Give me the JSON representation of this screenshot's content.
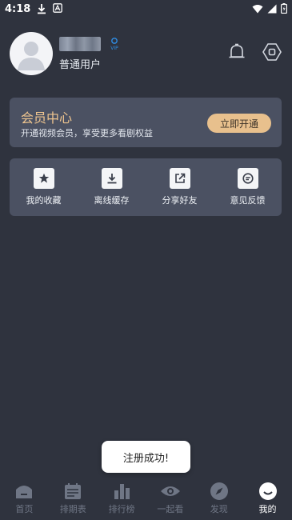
{
  "status": {
    "time": "4:18"
  },
  "profile": {
    "level": "普通用户",
    "vip_icon": "vip-badge-icon"
  },
  "member": {
    "title": "会员中心",
    "subtitle": "开通视频会员，享受更多看剧权益",
    "button": "立即开通"
  },
  "tools": [
    {
      "label": "我的收藏",
      "icon": "star-icon"
    },
    {
      "label": "离线缓存",
      "icon": "download-icon"
    },
    {
      "label": "分享好友",
      "icon": "share-icon"
    },
    {
      "label": "意见反馈",
      "icon": "feedback-icon"
    }
  ],
  "toast": {
    "text": "注册成功!"
  },
  "tabs": [
    {
      "label": "首页",
      "icon": "home-icon"
    },
    {
      "label": "排期表",
      "icon": "calendar-icon"
    },
    {
      "label": "排行榜",
      "icon": "ranking-icon"
    },
    {
      "label": "一起看",
      "icon": "eye-icon"
    },
    {
      "label": "发现",
      "icon": "compass-icon"
    },
    {
      "label": "我的",
      "icon": "profile-tab-icon"
    }
  ],
  "colors": {
    "background": "#2f333e",
    "card": "#4b5162",
    "accent_gold": "#e8c08d",
    "vip_blue": "#2f8ee6"
  }
}
